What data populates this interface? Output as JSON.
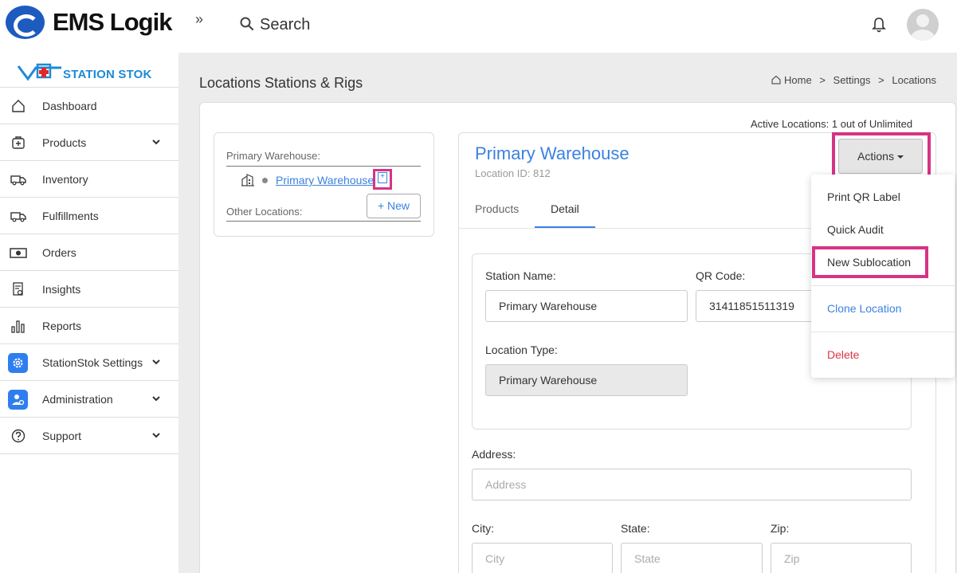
{
  "header": {
    "logo_text": "EMS Logik",
    "collapse_label": "»",
    "search_label": "Search"
  },
  "sidebar": {
    "brand": "STATION STOK",
    "items": [
      {
        "label": "Dashboard",
        "icon": "home-icon",
        "has_submenu": false
      },
      {
        "label": "Products",
        "icon": "product-box-icon",
        "has_submenu": true
      },
      {
        "label": "Inventory",
        "icon": "truck-icon",
        "has_submenu": false
      },
      {
        "label": "Fulfillments",
        "icon": "truck-icon",
        "has_submenu": false
      },
      {
        "label": "Orders",
        "icon": "cash-icon",
        "has_submenu": false
      },
      {
        "label": "Insights",
        "icon": "report-search-icon",
        "has_submenu": false
      },
      {
        "label": "Reports",
        "icon": "bar-chart-icon",
        "has_submenu": false
      },
      {
        "label": "StationStok Settings",
        "icon": "gear-icon",
        "has_submenu": true
      },
      {
        "label": "Administration",
        "icon": "user-admin-icon",
        "has_submenu": true
      },
      {
        "label": "Support",
        "icon": "help-circle-icon",
        "has_submenu": true
      }
    ]
  },
  "page": {
    "title": "Locations Stations & Rigs",
    "breadcrumb": [
      "Home",
      ">",
      "Settings",
      ">",
      "Locations"
    ],
    "active_locations": "Active Locations: 1 out of Unlimited"
  },
  "tree": {
    "primary_heading": "Primary Warehouse:",
    "primary_item": "Primary Warehouse",
    "other_heading": "Other Locations:",
    "new_button": "+ New"
  },
  "detail": {
    "title": "Primary Warehouse",
    "location_id": "Location ID: 812",
    "tabs": [
      "Products",
      "Detail"
    ],
    "active_tab": "Detail",
    "station_name_label": "Station Name:",
    "station_name_value": "Primary Warehouse",
    "qr_code_label": "QR Code:",
    "qr_code_value": "31411851511319",
    "location_type_label": "Location Type:",
    "location_type_value": "Primary Warehouse",
    "address_label": "Address:",
    "address_placeholder": "Address",
    "city_label": "City:",
    "city_placeholder": "City",
    "state_label": "State:",
    "state_placeholder": "State",
    "zip_label": "Zip:",
    "zip_placeholder": "Zip"
  },
  "actions": {
    "button_label": "Actions",
    "menu": [
      {
        "label": "Print QR Label",
        "color": "#333333"
      },
      {
        "label": "Quick Audit",
        "color": "#333333"
      },
      {
        "label": "New Sublocation",
        "color": "#333333"
      },
      {
        "label": "Clone Location",
        "color": "#3b82e0"
      },
      {
        "label": "Delete",
        "color": "#dc3545"
      }
    ]
  },
  "colors": {
    "accent": "#3b82e0",
    "highlight": "#d63384",
    "danger": "#dc3545"
  }
}
